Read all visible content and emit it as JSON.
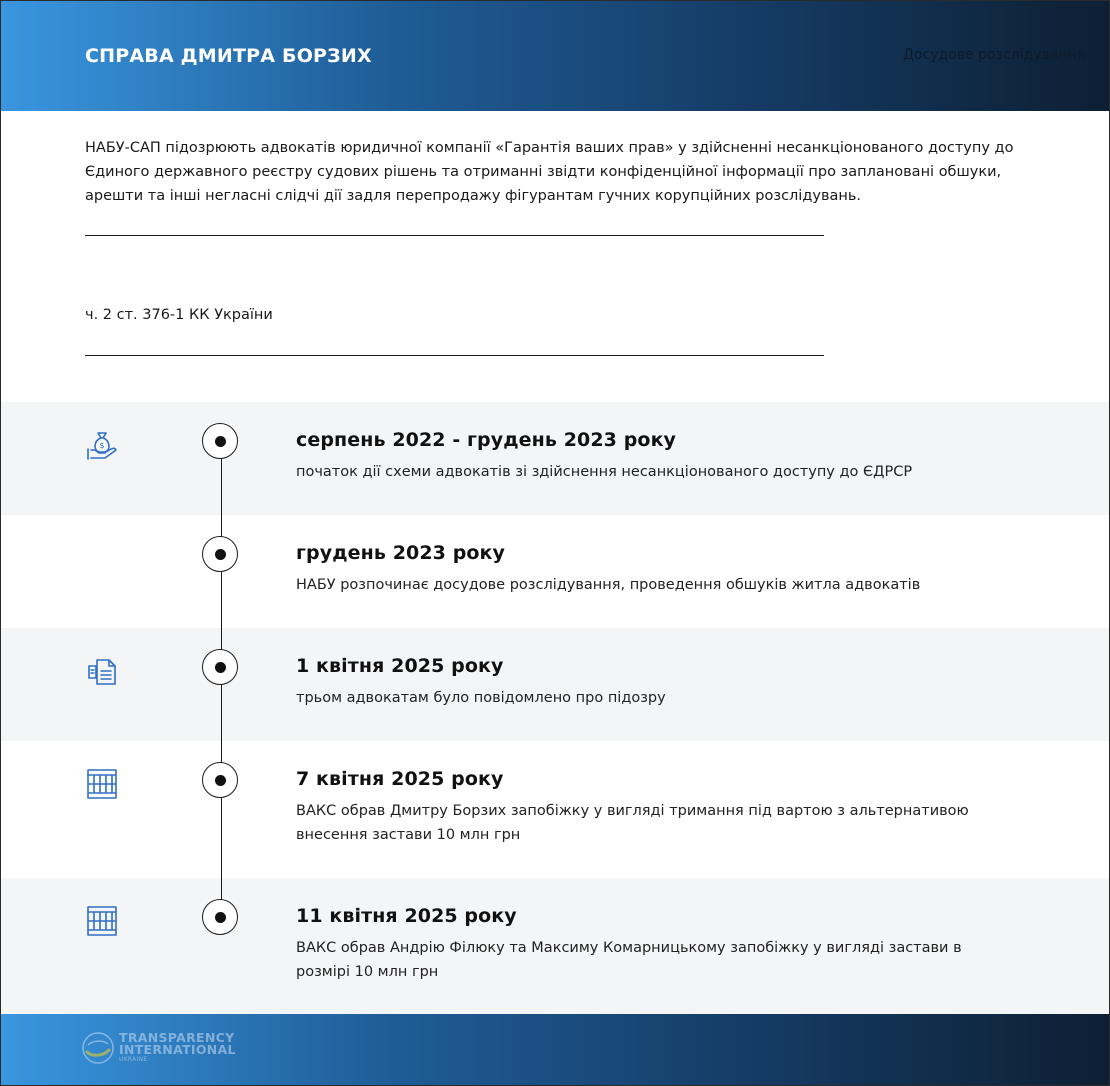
{
  "header": {
    "title": "СПРАВА ДМИТРА БОРЗИХ",
    "stage": "Досудове розслідування"
  },
  "intro": {
    "text": "НАБУ-САП підозрюють адвокатів юридичної компанії «Гарантія ваших прав» у здійсненні несанкціонованого доступу до Єдиного державного реєстру судових рішень та отриманні звідти конфіденційної інформації про заплановані обшуки, арешти та інші негласні слідчі дії задля перепродажу фігурантам гучних корупційних розслідувань."
  },
  "article": {
    "text": "ч. 2 ст. 376-1 КК України"
  },
  "timeline": [
    {
      "date": "серпень 2022 - грудень 2023 року",
      "description": "початок дії схеми адвокатів зі здійснення несанкціонованого доступу до ЄДРСР",
      "icon": "money-bag-hand-icon"
    },
    {
      "date": "грудень 2023 року",
      "description": "НАБУ розпочинає досудове розслідування, проведення обшуків житла адвокатів",
      "icon": ""
    },
    {
      "date": "1 квітня 2025 року",
      "description": "трьом адвокатам було повідомлено про підозру",
      "icon": "documents-icon"
    },
    {
      "date": "7 квітня 2025 року",
      "description": "ВАКС обрав Дмитру Борзих запобіжку у вигляді тримання під вартою з альтернативою внесення застави 10 млн грн",
      "icon": "prison-bars-icon"
    },
    {
      "date": "11 квітня 2025 року",
      "description": "ВАКС обрав Андрію Філюку та Максиму Комарницькому запобіжку у вигляді застави в розмірі 10 млн грн",
      "icon": "prison-bars-icon"
    }
  ],
  "footer": {
    "logo_line1": "TRANSPARENCY",
    "logo_line2": "INTERNATIONAL",
    "logo_line3": "UKRAINE"
  },
  "colors": {
    "accent": "#3a96df",
    "dark": "#0d1f33",
    "icon": "#2f6fc4"
  }
}
